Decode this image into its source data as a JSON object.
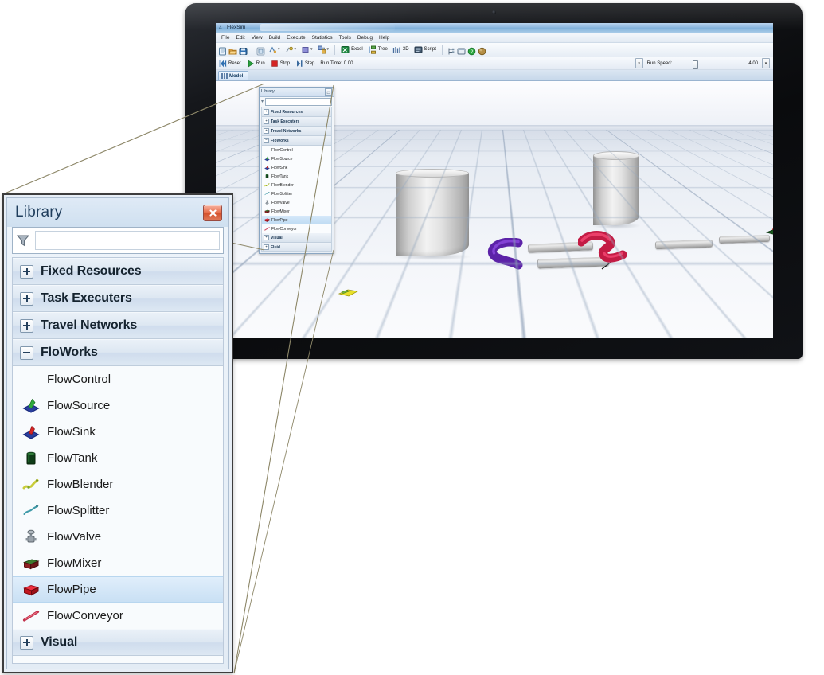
{
  "app": {
    "title": "FlexSim",
    "menus": [
      "File",
      "Edit",
      "View",
      "Build",
      "Execute",
      "Statistics",
      "Tools",
      "Debug",
      "Help"
    ],
    "toolbar": {
      "new_label": "new-file",
      "open_label": "open-file",
      "save_label": "save-file",
      "excel_label": "Excel",
      "tree_label": "Tree",
      "view3d_label": "3D",
      "script_label": "Script"
    },
    "runbar": {
      "reset_label": "Reset",
      "run_label": "Run",
      "stop_label": "Stop",
      "step_label": "Step",
      "runtime_label": "Run Time:",
      "runtime_value": "0.00",
      "runspeed_label": "Run Speed:",
      "runspeed_value": "4.00",
      "spinner_glyph": "▾"
    },
    "tabs": [
      {
        "label": "Model"
      }
    ]
  },
  "library_small": {
    "title": "Library",
    "close_glyph": "□",
    "search_value": "",
    "filter_icon": "funnel-icon",
    "rows": [
      {
        "kind": "cat",
        "label": "Fixed Resources",
        "state": "collapsed"
      },
      {
        "kind": "cat",
        "label": "Task Executers",
        "state": "collapsed"
      },
      {
        "kind": "cat",
        "label": "Travel Networks",
        "state": "collapsed"
      },
      {
        "kind": "cat",
        "label": "FloWorks",
        "state": "expanded"
      },
      {
        "kind": "item",
        "label": "FlowControl",
        "icon": "none",
        "selected": false
      },
      {
        "kind": "item",
        "label": "FlowSource",
        "icon": "flowsource-icon",
        "selected": false
      },
      {
        "kind": "item",
        "label": "FlowSink",
        "icon": "flowsink-icon",
        "selected": false
      },
      {
        "kind": "item",
        "label": "FlowTank",
        "icon": "flowtank-icon",
        "selected": false
      },
      {
        "kind": "item",
        "label": "FlowBlender",
        "icon": "flowblender-icon",
        "selected": false
      },
      {
        "kind": "item",
        "label": "FlowSplitter",
        "icon": "flowsplitter-icon",
        "selected": false
      },
      {
        "kind": "item",
        "label": "FlowValve",
        "icon": "flowvalve-icon",
        "selected": false
      },
      {
        "kind": "item",
        "label": "FlowMixer",
        "icon": "flowmixer-icon",
        "selected": false
      },
      {
        "kind": "item",
        "label": "FlowPipe",
        "icon": "flowpipe-icon",
        "selected": true
      },
      {
        "kind": "item",
        "label": "FlowConveyor",
        "icon": "flowconveyor-icon",
        "selected": false
      },
      {
        "kind": "cat",
        "label": "Visual",
        "state": "collapsed"
      },
      {
        "kind": "cat",
        "label": "Fluid",
        "state": "collapsed"
      }
    ]
  },
  "library_big": {
    "title": "Library",
    "close_glyph": "×",
    "search_value": "",
    "search_placeholder": "",
    "filter_icon": "funnel-icon",
    "rows": [
      {
        "kind": "cat",
        "label": "Fixed Resources",
        "state": "collapsed"
      },
      {
        "kind": "cat",
        "label": "Task Executers",
        "state": "collapsed"
      },
      {
        "kind": "cat",
        "label": "Travel Networks",
        "state": "collapsed"
      },
      {
        "kind": "cat",
        "label": "FloWorks",
        "state": "expanded"
      },
      {
        "kind": "item",
        "label": "FlowControl",
        "icon": "none",
        "selected": false
      },
      {
        "kind": "item",
        "label": "FlowSource",
        "icon": "flowsource-icon",
        "selected": false
      },
      {
        "kind": "item",
        "label": "FlowSink",
        "icon": "flowsink-icon",
        "selected": false
      },
      {
        "kind": "item",
        "label": "FlowTank",
        "icon": "flowtank-icon",
        "selected": false
      },
      {
        "kind": "item",
        "label": "FlowBlender",
        "icon": "flowblender-icon",
        "selected": false
      },
      {
        "kind": "item",
        "label": "FlowSplitter",
        "icon": "flowsplitter-icon",
        "selected": false
      },
      {
        "kind": "item",
        "label": "FlowValve",
        "icon": "flowvalve-icon",
        "selected": false
      },
      {
        "kind": "item",
        "label": "FlowMixer",
        "icon": "flowmixer-icon",
        "selected": false
      },
      {
        "kind": "item",
        "label": "FlowPipe",
        "icon": "flowpipe-icon",
        "selected": true
      },
      {
        "kind": "item",
        "label": "FlowConveyor",
        "icon": "flowconveyor-icon",
        "selected": false
      },
      {
        "kind": "cat",
        "label": "Visual",
        "state": "collapsed"
      }
    ]
  },
  "colors": {
    "accent_blue": "#2f6fb0",
    "selection_blue": "#c9e0f4",
    "close_red": "#d4512c",
    "pipe_purple": "#6a2bb5",
    "pipe_red": "#e0305a",
    "pipe_grey": "#c9c9c9",
    "callout_line": "#8d8768",
    "bezel_black": "#0a0b0d"
  }
}
